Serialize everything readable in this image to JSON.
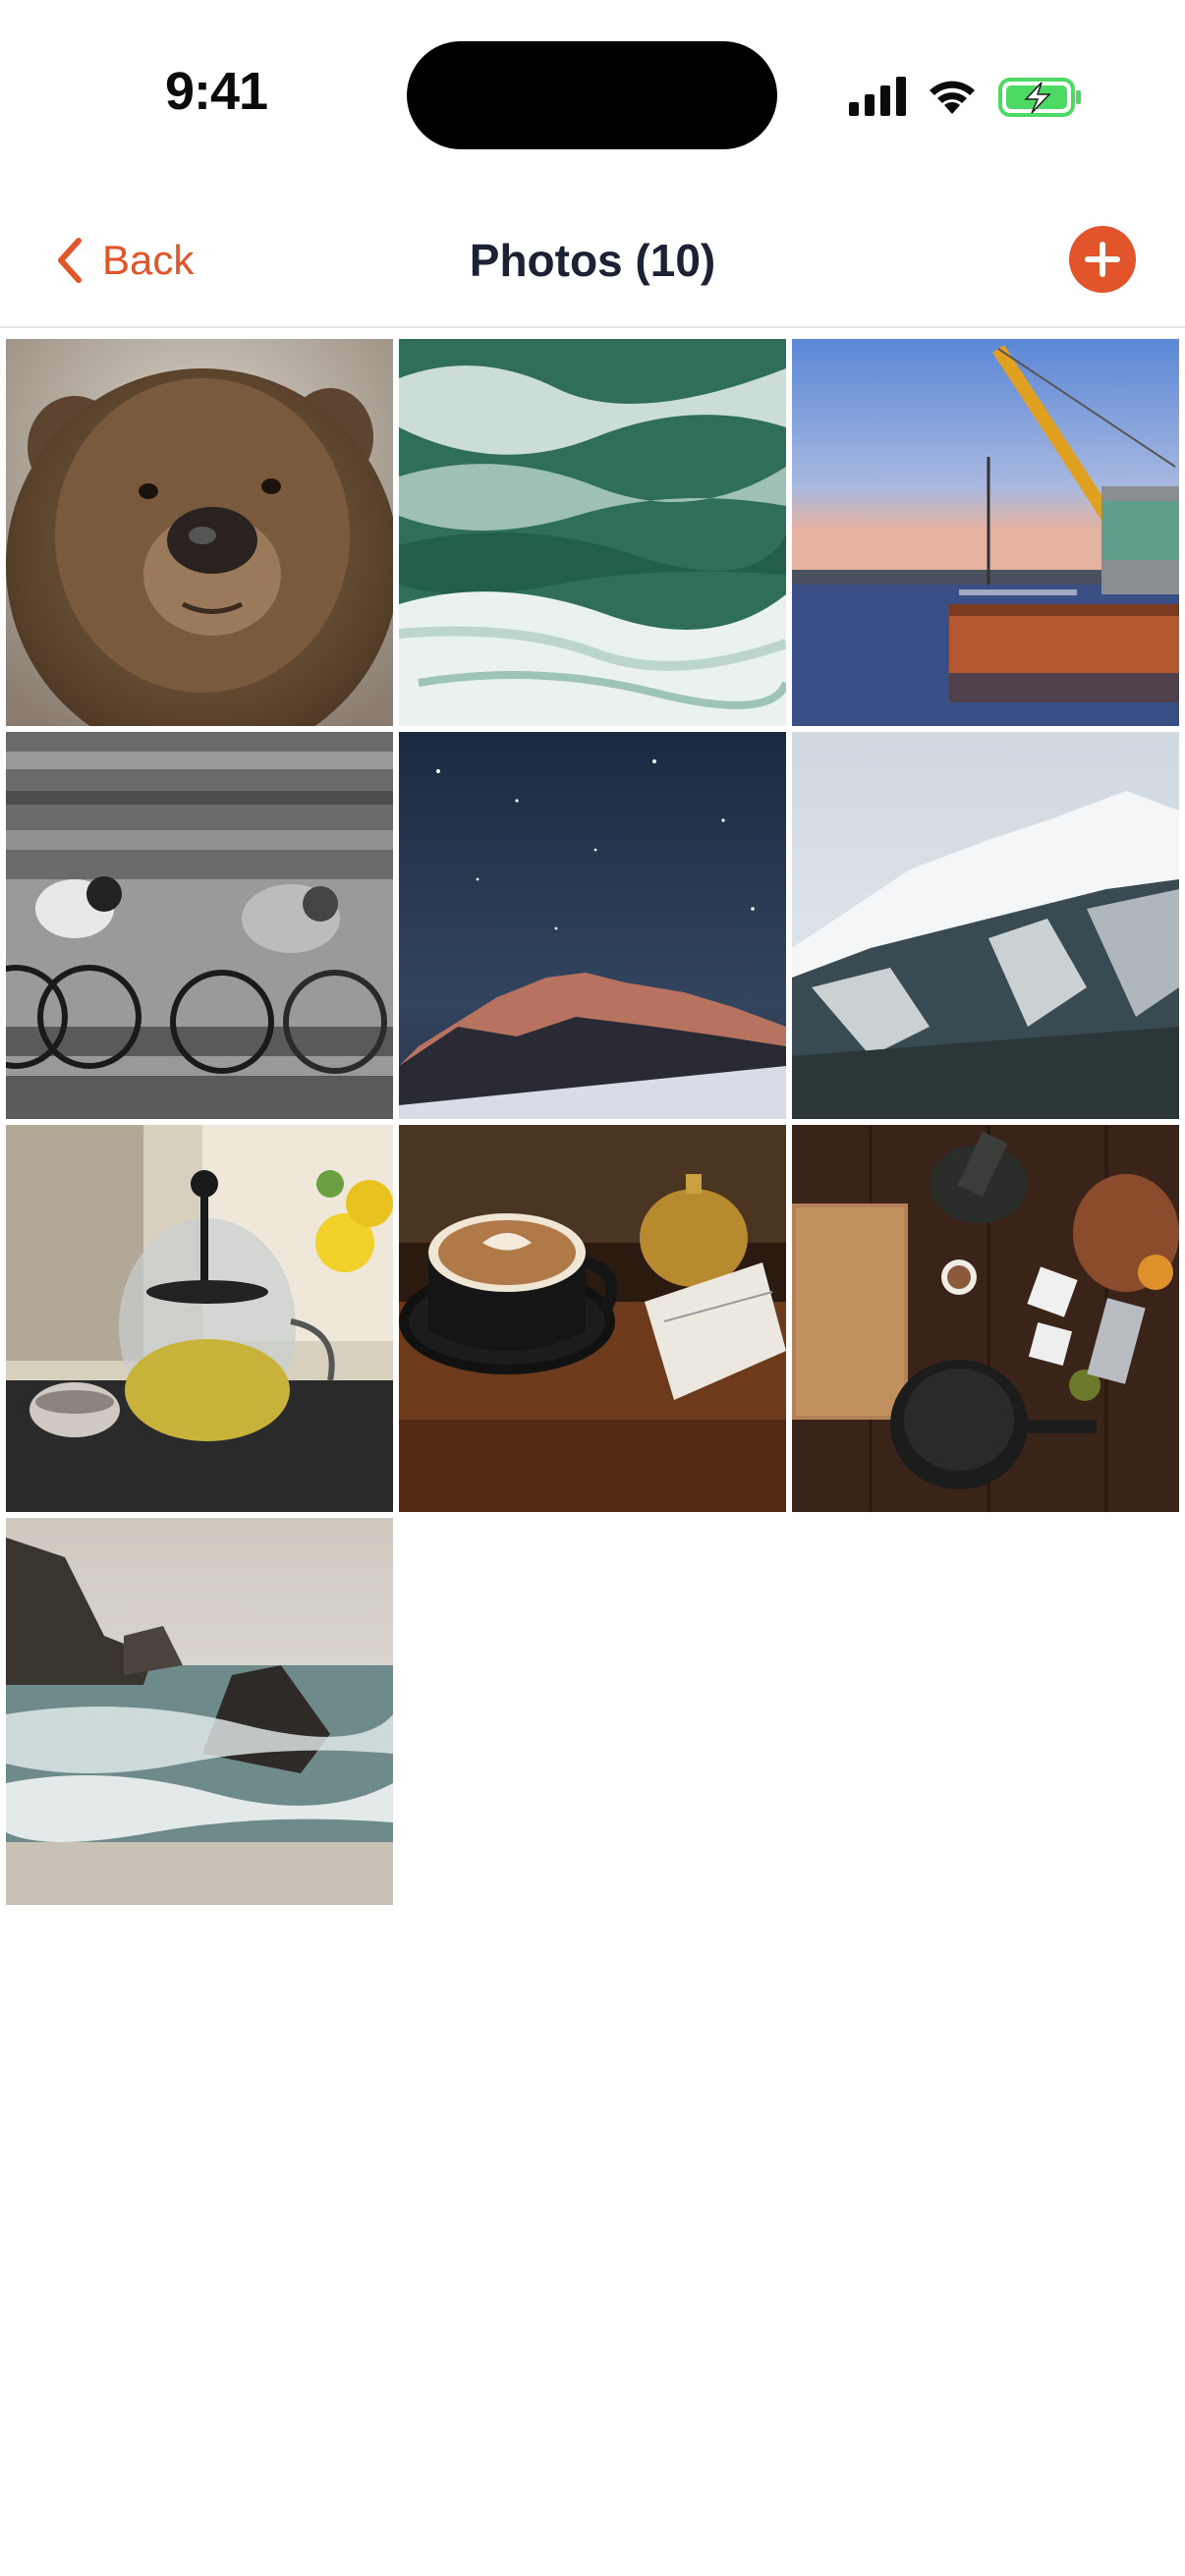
{
  "status_bar": {
    "time": "9:41",
    "icons": [
      "cellular-signal-icon",
      "wifi-icon",
      "battery-charging-icon"
    ]
  },
  "nav": {
    "back_label": "Back",
    "title": "Photos (10)",
    "add_icon": "plus-icon"
  },
  "colors": {
    "accent": "#e2542a",
    "title_text": "#1c2233",
    "divider": "#e3e3e6",
    "battery_green": "#4cd964"
  },
  "photos": [
    {
      "subject": "bear"
    },
    {
      "subject": "ocean-waves"
    },
    {
      "subject": "harbor-crane"
    },
    {
      "subject": "cyclists"
    },
    {
      "subject": "night-mountain"
    },
    {
      "subject": "snowy-mountain"
    },
    {
      "subject": "teapot"
    },
    {
      "subject": "coffee-latte"
    },
    {
      "subject": "kitchen-table"
    },
    {
      "subject": "sea-rocks"
    }
  ]
}
